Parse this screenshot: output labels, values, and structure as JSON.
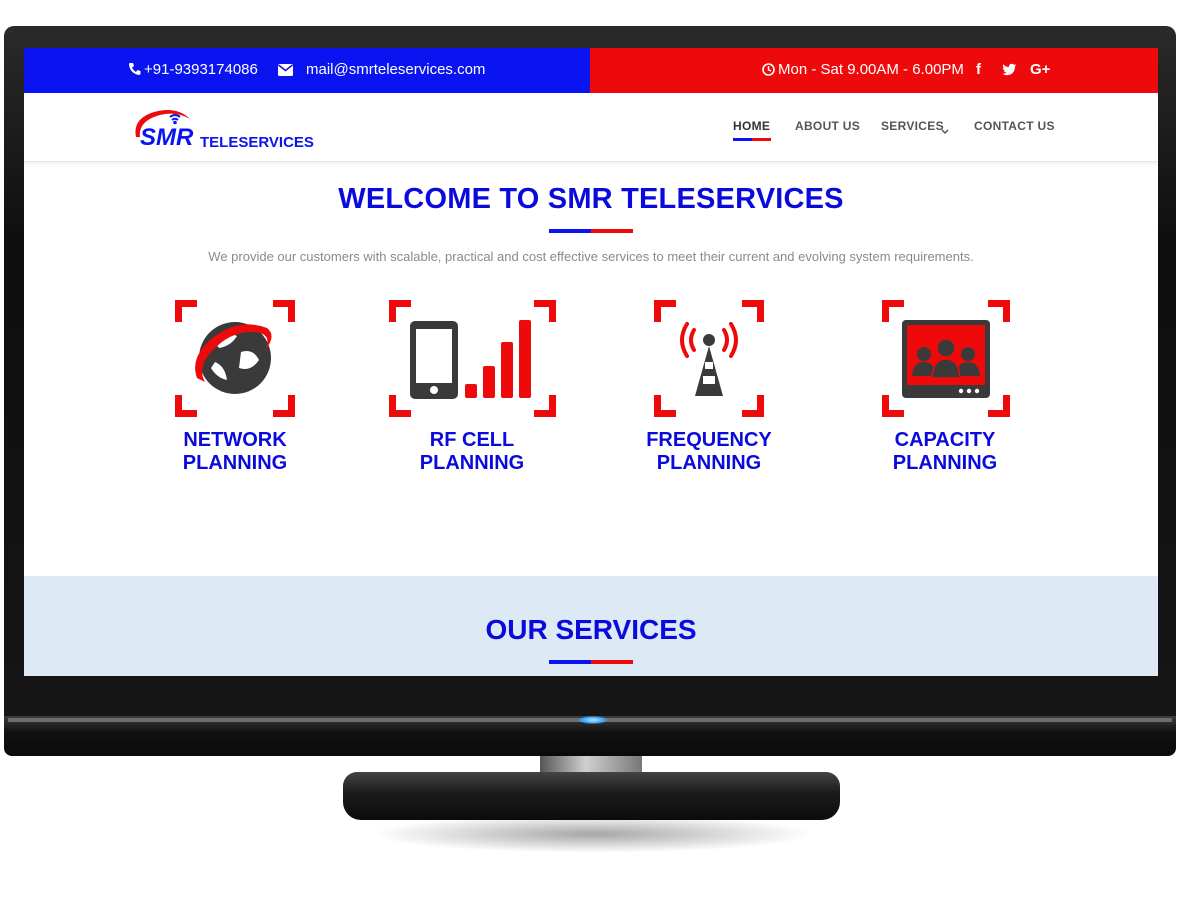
{
  "topbar": {
    "phone": "+91-9393174086",
    "email": "mail@smrteleservices.com",
    "hours": "Mon - Sat 9.00AM - 6.00PM",
    "social": [
      "f",
      "t",
      "G+"
    ]
  },
  "logo": {
    "brand": "SMR",
    "suffix": "TELESERVICES"
  },
  "nav": {
    "items": [
      {
        "label": "HOME"
      },
      {
        "label": "ABOUT US"
      },
      {
        "label": "SERVICES"
      },
      {
        "label": "CONTACT US"
      }
    ]
  },
  "welcome": {
    "title": "WELCOME TO SMR TELESERVICES",
    "intro": "We provide our customers with scalable, practical and cost effective services to meet their current and evolving system requirements."
  },
  "features": [
    {
      "line1": "NETWORK",
      "line2": "PLANNING",
      "icon": "globe-icon"
    },
    {
      "line1": "RF CELL",
      "line2": "PLANNING",
      "icon": "mobile-signal-icon"
    },
    {
      "line1": "FREQUENCY",
      "line2": "PLANNING",
      "icon": "antenna-tower-icon"
    },
    {
      "line1": "CAPACITY",
      "line2": "PLANNING",
      "icon": "users-screen-icon"
    }
  ],
  "services": {
    "title": "OUR SERVICES"
  },
  "colors": {
    "blue": "#0a14f0",
    "red": "#ee0a0a",
    "heading": "#0a0adc",
    "band": "#dde9f5"
  }
}
